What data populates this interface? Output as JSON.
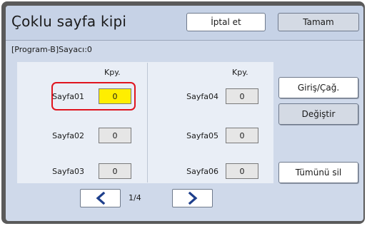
{
  "header": {
    "title": "Çoklu sayfa kipi",
    "cancel_label": "İptal et",
    "ok_label": "Tamam"
  },
  "counter_text": "[Program-B]Sayacı:0",
  "column_header": "Kpy.",
  "pages": [
    {
      "label": "Sayfa01",
      "value": "0",
      "selected": true
    },
    {
      "label": "Sayfa02",
      "value": "0",
      "selected": false
    },
    {
      "label": "Sayfa03",
      "value": "0",
      "selected": false
    },
    {
      "label": "Sayfa04",
      "value": "0",
      "selected": false
    },
    {
      "label": "Sayfa05",
      "value": "0",
      "selected": false
    },
    {
      "label": "Sayfa06",
      "value": "0",
      "selected": false
    }
  ],
  "side_buttons": {
    "entry_label": "Giriş/Çağ.",
    "change_label": "Değiştir",
    "delete_all_label": "Tümünü sil"
  },
  "pagination": {
    "current": "1/4",
    "prev_icon": "chevron-left-icon",
    "next_icon": "chevron-right-icon"
  },
  "colors": {
    "selected_value_bg": "#ffee00",
    "highlight_border": "#e0141e",
    "arrow_color": "#1e3f8c"
  }
}
